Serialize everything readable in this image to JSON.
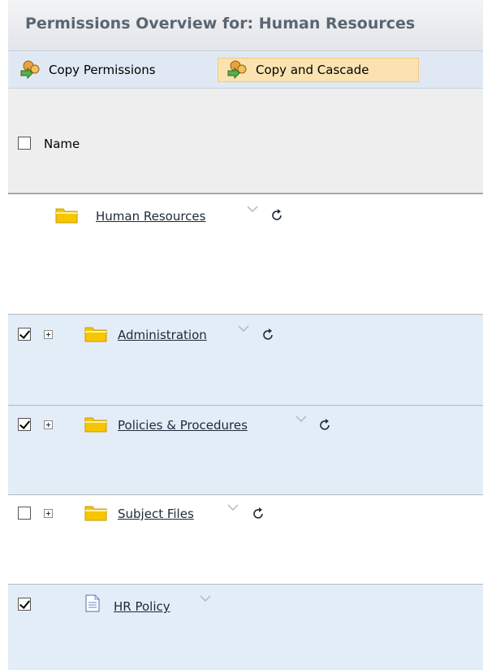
{
  "panel": {
    "title": "Permissions Overview for: Human Resources"
  },
  "toolbar": {
    "copy_permissions_label": "Copy Permissions",
    "copy_and_cascade_label": "Copy and Cascade"
  },
  "table": {
    "header": {
      "name_label": "Name",
      "checked": false
    },
    "rows": [
      {
        "label": "Human Resources",
        "type": "folder",
        "checked": null,
        "expandable": false,
        "refresh": true
      },
      {
        "label": "Administration",
        "type": "folder",
        "checked": true,
        "expandable": true,
        "refresh": true
      },
      {
        "label": "Policies & Procedures",
        "type": "folder",
        "checked": true,
        "expandable": true,
        "refresh": true
      },
      {
        "label": "Subject Files",
        "type": "folder",
        "checked": false,
        "expandable": true,
        "refresh": true
      },
      {
        "label": "HR Policy",
        "type": "document",
        "checked": true,
        "expandable": false,
        "refresh": false
      }
    ]
  },
  "colors": {
    "title_text": "#5a6672",
    "toolbar_bg": "#e0e9f3",
    "cascade_highlight": "#fbe3b1",
    "row_blue": "#e3edf7",
    "header_bg": "#eeeeee",
    "folder": "#f7c600"
  }
}
